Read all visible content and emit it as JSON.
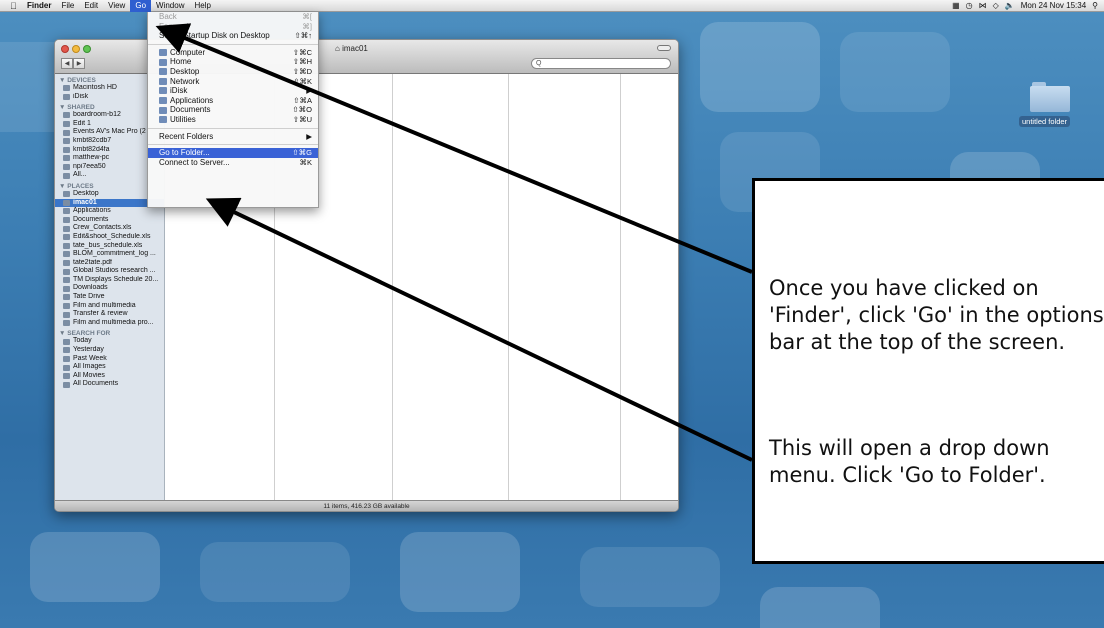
{
  "menubar": {
    "app": "Finder",
    "items": [
      "File",
      "Edit",
      "View",
      "Go",
      "Window",
      "Help"
    ],
    "active": "Go",
    "clock": "Mon 24 Nov  15:34"
  },
  "finder": {
    "title": "imac01",
    "search_placeholder": "Q",
    "status": "11 items, 416.23 GB available",
    "sidebar": {
      "devices_header": "▼ DEVICES",
      "devices": [
        "Macintosh HD",
        "iDisk"
      ],
      "shared_header": "▼ SHARED",
      "shared": [
        "boardroom-b12",
        "Edit 1",
        "Events AV's Mac Pro (2",
        "kmbt82cdb7",
        "kmbt82d4fa",
        "matthew-pc",
        "npi7eea50",
        "All..."
      ],
      "places_header": "▼ PLACES",
      "places": [
        "Desktop",
        "imac01",
        "Applications",
        "Documents",
        "Crew_Contacts.xls",
        "Edit&shoot_Schedule.xls",
        "tate_bus_schedule.xls",
        "BLOM_commitment_log ...",
        "tate2tate.pdf",
        "Global Studios research ...",
        "TM Displays Schedule 20...",
        "Downloads",
        "Tate Drive",
        "Film and multimedia",
        "Transfer & review",
        "Film and multimedia pro..."
      ],
      "places_selected": "imac01",
      "search_header": "▼ SEARCH FOR",
      "search": [
        "Today",
        "Yesterday",
        "Past Week",
        "All Images",
        "All Movies",
        "All Documents"
      ]
    }
  },
  "go_menu": {
    "items": [
      {
        "label": "Back",
        "shortcut": "⌘[",
        "disabled": true
      },
      {
        "label": "Forward",
        "shortcut": "⌘]",
        "disabled": true
      },
      {
        "label": "Select Startup Disk on Desktop",
        "shortcut": "⇧⌘↑"
      },
      {
        "sep": true
      },
      {
        "label": "Computer",
        "shortcut": "⇧⌘C"
      },
      {
        "label": "Home",
        "shortcut": "⇧⌘H"
      },
      {
        "label": "Desktop",
        "shortcut": "⇧⌘D"
      },
      {
        "label": "Network",
        "shortcut": "⇧⌘K"
      },
      {
        "label": "iDisk",
        "shortcut": "▶"
      },
      {
        "label": "Applications",
        "shortcut": "⇧⌘A"
      },
      {
        "label": "Documents",
        "shortcut": "⇧⌘O"
      },
      {
        "label": "Utilities",
        "shortcut": "⇧⌘U"
      },
      {
        "sep": true
      },
      {
        "label": "Recent Folders",
        "shortcut": "▶"
      },
      {
        "sep": true
      },
      {
        "label": "Go to Folder...",
        "shortcut": "⇧⌘G",
        "highlighted": true
      },
      {
        "label": "Connect to Server...",
        "shortcut": "⌘K"
      }
    ]
  },
  "desktop": {
    "folder_label": "untitled folder"
  },
  "callout": {
    "paragraph1": "Once you have clicked on 'Finder', click 'Go' in the options bar at the top of the screen.",
    "paragraph2": "This will open a drop down menu. Click 'Go to Folder'."
  }
}
